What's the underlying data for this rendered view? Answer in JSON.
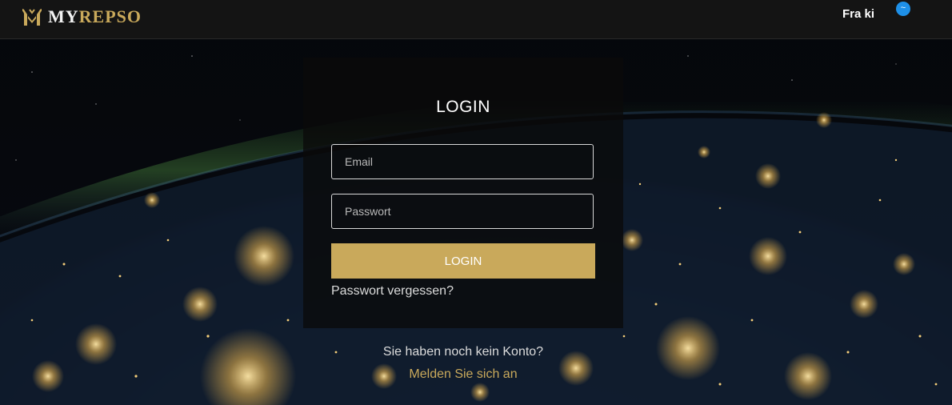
{
  "header": {
    "logo_my": "MY",
    "logo_repso": "REPSO",
    "user_name": "Fra ki",
    "notification_badge": "~"
  },
  "login": {
    "title": "LOGIN",
    "email_placeholder": "Email",
    "password_placeholder": "Passwort",
    "button_label": "LOGIN",
    "forgot_link": "Passwort vergessen?"
  },
  "footer": {
    "no_account_text": "Sie haben noch kein Konto?",
    "register_link": "Melden Sie sich an"
  },
  "colors": {
    "accent_gold": "#c9a95b",
    "topbar": "#141414",
    "badge_blue": "#1e90e8"
  }
}
